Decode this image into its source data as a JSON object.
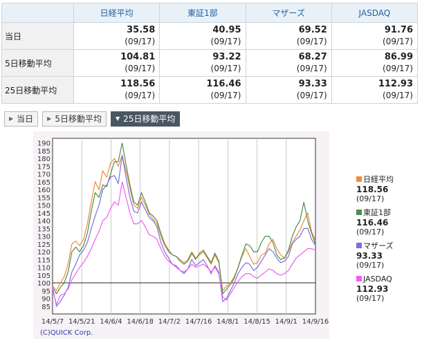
{
  "table": {
    "headers": [
      "",
      "日経平均",
      "東証1部",
      "マザーズ",
      "JASDAQ"
    ],
    "rows": [
      {
        "label": "当日",
        "cells": [
          {
            "value": "35.58",
            "date": "(09/17)"
          },
          {
            "value": "40.95",
            "date": "(09/17)"
          },
          {
            "value": "69.52",
            "date": "(09/17)"
          },
          {
            "value": "91.76",
            "date": "(09/17)"
          }
        ]
      },
      {
        "label": "5日移動平均",
        "cells": [
          {
            "value": "104.81",
            "date": "(09/17)"
          },
          {
            "value": "93.22",
            "date": "(09/17)"
          },
          {
            "value": "68.27",
            "date": "(09/17)"
          },
          {
            "value": "86.99",
            "date": "(09/17)"
          }
        ]
      },
      {
        "label": "25日移動平均",
        "cells": [
          {
            "value": "118.56",
            "date": "(09/17)"
          },
          {
            "value": "116.46",
            "date": "(09/17)"
          },
          {
            "value": "93.33",
            "date": "(09/17)"
          },
          {
            "value": "112.93",
            "date": "(09/17)"
          }
        ]
      }
    ]
  },
  "tabs": [
    {
      "label": "当日",
      "active": false
    },
    {
      "label": "5日移動平均",
      "active": false
    },
    {
      "label": "25日移動平均",
      "active": true
    }
  ],
  "colors": {
    "nikkei": "#f08a3c",
    "tosho1": "#4d8c4d",
    "mothers": "#7b6fe0",
    "jasdaq": "#f25cf0"
  },
  "chart_data": {
    "type": "line",
    "ylim": [
      80,
      193
    ],
    "yticks": [
      85,
      90,
      95,
      100,
      105,
      110,
      115,
      120,
      125,
      130,
      135,
      140,
      145,
      150,
      155,
      160,
      165,
      170,
      175,
      180,
      185,
      190
    ],
    "xticks": [
      "14/5/7",
      "14/5/21",
      "14/6/4",
      "14/6/18",
      "14/7/2",
      "14/7/16",
      "14/8/1",
      "14/8/15",
      "14/9/1",
      "14/9/16"
    ],
    "reference_line": 100,
    "grid": "vertical",
    "legend_position": "right",
    "copyright": "(C)QUICK Corp.",
    "series": [
      {
        "name": "日経平均",
        "color": "#f08a3c",
        "last_value": "118.56",
        "last_date": "(09/17)",
        "values": [
          98,
          95,
          100,
          104,
          112,
          125,
          127,
          124,
          128,
          138,
          152,
          165,
          160,
          172,
          168,
          177,
          180,
          175,
          182,
          172,
          161,
          150,
          148,
          155,
          150,
          144,
          141,
          138,
          130,
          124,
          120,
          118,
          117,
          115,
          113,
          115,
          120,
          116,
          118,
          120,
          116,
          112,
          118,
          113,
          95,
          98,
          100,
          104,
          110,
          117,
          122,
          117,
          112,
          113,
          118,
          119,
          125,
          128,
          122,
          118,
          116,
          120,
          126,
          130,
          134,
          140,
          145,
          133,
          127
        ]
      },
      {
        "name": "東証1部",
        "color": "#4d8c4d",
        "last_value": "116.46",
        "last_date": "(09/17)",
        "values": [
          97,
          93,
          97,
          100,
          107,
          120,
          123,
          120,
          124,
          132,
          146,
          158,
          155,
          163,
          162,
          170,
          178,
          178,
          190,
          176,
          163,
          152,
          150,
          158,
          152,
          145,
          143,
          140,
          132,
          125,
          121,
          118,
          117,
          114,
          112,
          114,
          119,
          115,
          119,
          121,
          117,
          113,
          119,
          114,
          93,
          96,
          99,
          103,
          110,
          118,
          125,
          124,
          120,
          120,
          126,
          130,
          130,
          126,
          118,
          115,
          116,
          121,
          130,
          136,
          140,
          152,
          140,
          132,
          125
        ]
      },
      {
        "name": "マザーズ",
        "color": "#7b6fe0",
        "last_value": "93.33",
        "last_date": "(09/17)",
        "values": [
          97,
          85,
          88,
          92,
          97,
          107,
          112,
          118,
          121,
          126,
          135,
          143,
          150,
          160,
          163,
          168,
          169,
          164,
          182,
          168,
          155,
          146,
          145,
          152,
          147,
          142,
          140,
          136,
          126,
          120,
          116,
          112,
          111,
          108,
          106,
          109,
          115,
          111,
          113,
          115,
          111,
          106,
          111,
          107,
          88,
          90,
          95,
          100,
          106,
          110,
          113,
          112,
          108,
          110,
          114,
          118,
          122,
          120,
          116,
          113,
          114,
          117,
          125,
          128,
          130,
          135,
          135,
          128,
          124
        ]
      },
      {
        "name": "JASDAQ",
        "color": "#f25cf0",
        "last_value": "112.93",
        "last_date": "(09/17)",
        "values": [
          96,
          86,
          92,
          93,
          96,
          102,
          106,
          110,
          113,
          117,
          122,
          128,
          133,
          140,
          142,
          148,
          152,
          150,
          165,
          155,
          145,
          138,
          138,
          140,
          136,
          131,
          130,
          128,
          122,
          117,
          114,
          112,
          110,
          108,
          107,
          109,
          112,
          110,
          111,
          112,
          110,
          107,
          110,
          106,
          91,
          89,
          93,
          97,
          101,
          104,
          106,
          106,
          104,
          103,
          105,
          107,
          109,
          108,
          106,
          105,
          106,
          108,
          112,
          116,
          118,
          120,
          122,
          122,
          121
        ]
      }
    ]
  }
}
